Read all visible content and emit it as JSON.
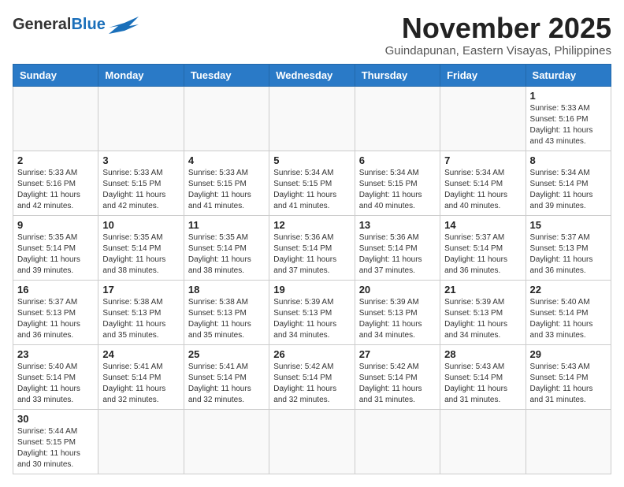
{
  "header": {
    "logo_text_general": "General",
    "logo_text_blue": "Blue",
    "month_title": "November 2025",
    "location": "Guindapunan, Eastern Visayas, Philippines"
  },
  "days_of_week": [
    "Sunday",
    "Monday",
    "Tuesday",
    "Wednesday",
    "Thursday",
    "Friday",
    "Saturday"
  ],
  "weeks": [
    {
      "days": [
        {
          "number": "",
          "sunrise": "",
          "sunset": "",
          "daylight": ""
        },
        {
          "number": "",
          "sunrise": "",
          "sunset": "",
          "daylight": ""
        },
        {
          "number": "",
          "sunrise": "",
          "sunset": "",
          "daylight": ""
        },
        {
          "number": "",
          "sunrise": "",
          "sunset": "",
          "daylight": ""
        },
        {
          "number": "",
          "sunrise": "",
          "sunset": "",
          "daylight": ""
        },
        {
          "number": "",
          "sunrise": "",
          "sunset": "",
          "daylight": ""
        },
        {
          "number": "1",
          "sunrise": "Sunrise: 5:33 AM",
          "sunset": "Sunset: 5:16 PM",
          "daylight": "Daylight: 11 hours and 43 minutes."
        }
      ]
    },
    {
      "days": [
        {
          "number": "2",
          "sunrise": "Sunrise: 5:33 AM",
          "sunset": "Sunset: 5:16 PM",
          "daylight": "Daylight: 11 hours and 42 minutes."
        },
        {
          "number": "3",
          "sunrise": "Sunrise: 5:33 AM",
          "sunset": "Sunset: 5:15 PM",
          "daylight": "Daylight: 11 hours and 42 minutes."
        },
        {
          "number": "4",
          "sunrise": "Sunrise: 5:33 AM",
          "sunset": "Sunset: 5:15 PM",
          "daylight": "Daylight: 11 hours and 41 minutes."
        },
        {
          "number": "5",
          "sunrise": "Sunrise: 5:34 AM",
          "sunset": "Sunset: 5:15 PM",
          "daylight": "Daylight: 11 hours and 41 minutes."
        },
        {
          "number": "6",
          "sunrise": "Sunrise: 5:34 AM",
          "sunset": "Sunset: 5:15 PM",
          "daylight": "Daylight: 11 hours and 40 minutes."
        },
        {
          "number": "7",
          "sunrise": "Sunrise: 5:34 AM",
          "sunset": "Sunset: 5:14 PM",
          "daylight": "Daylight: 11 hours and 40 minutes."
        },
        {
          "number": "8",
          "sunrise": "Sunrise: 5:34 AM",
          "sunset": "Sunset: 5:14 PM",
          "daylight": "Daylight: 11 hours and 39 minutes."
        }
      ]
    },
    {
      "days": [
        {
          "number": "9",
          "sunrise": "Sunrise: 5:35 AM",
          "sunset": "Sunset: 5:14 PM",
          "daylight": "Daylight: 11 hours and 39 minutes."
        },
        {
          "number": "10",
          "sunrise": "Sunrise: 5:35 AM",
          "sunset": "Sunset: 5:14 PM",
          "daylight": "Daylight: 11 hours and 38 minutes."
        },
        {
          "number": "11",
          "sunrise": "Sunrise: 5:35 AM",
          "sunset": "Sunset: 5:14 PM",
          "daylight": "Daylight: 11 hours and 38 minutes."
        },
        {
          "number": "12",
          "sunrise": "Sunrise: 5:36 AM",
          "sunset": "Sunset: 5:14 PM",
          "daylight": "Daylight: 11 hours and 37 minutes."
        },
        {
          "number": "13",
          "sunrise": "Sunrise: 5:36 AM",
          "sunset": "Sunset: 5:14 PM",
          "daylight": "Daylight: 11 hours and 37 minutes."
        },
        {
          "number": "14",
          "sunrise": "Sunrise: 5:37 AM",
          "sunset": "Sunset: 5:14 PM",
          "daylight": "Daylight: 11 hours and 36 minutes."
        },
        {
          "number": "15",
          "sunrise": "Sunrise: 5:37 AM",
          "sunset": "Sunset: 5:13 PM",
          "daylight": "Daylight: 11 hours and 36 minutes."
        }
      ]
    },
    {
      "days": [
        {
          "number": "16",
          "sunrise": "Sunrise: 5:37 AM",
          "sunset": "Sunset: 5:13 PM",
          "daylight": "Daylight: 11 hours and 36 minutes."
        },
        {
          "number": "17",
          "sunrise": "Sunrise: 5:38 AM",
          "sunset": "Sunset: 5:13 PM",
          "daylight": "Daylight: 11 hours and 35 minutes."
        },
        {
          "number": "18",
          "sunrise": "Sunrise: 5:38 AM",
          "sunset": "Sunset: 5:13 PM",
          "daylight": "Daylight: 11 hours and 35 minutes."
        },
        {
          "number": "19",
          "sunrise": "Sunrise: 5:39 AM",
          "sunset": "Sunset: 5:13 PM",
          "daylight": "Daylight: 11 hours and 34 minutes."
        },
        {
          "number": "20",
          "sunrise": "Sunrise: 5:39 AM",
          "sunset": "Sunset: 5:13 PM",
          "daylight": "Daylight: 11 hours and 34 minutes."
        },
        {
          "number": "21",
          "sunrise": "Sunrise: 5:39 AM",
          "sunset": "Sunset: 5:13 PM",
          "daylight": "Daylight: 11 hours and 34 minutes."
        },
        {
          "number": "22",
          "sunrise": "Sunrise: 5:40 AM",
          "sunset": "Sunset: 5:14 PM",
          "daylight": "Daylight: 11 hours and 33 minutes."
        }
      ]
    },
    {
      "days": [
        {
          "number": "23",
          "sunrise": "Sunrise: 5:40 AM",
          "sunset": "Sunset: 5:14 PM",
          "daylight": "Daylight: 11 hours and 33 minutes."
        },
        {
          "number": "24",
          "sunrise": "Sunrise: 5:41 AM",
          "sunset": "Sunset: 5:14 PM",
          "daylight": "Daylight: 11 hours and 32 minutes."
        },
        {
          "number": "25",
          "sunrise": "Sunrise: 5:41 AM",
          "sunset": "Sunset: 5:14 PM",
          "daylight": "Daylight: 11 hours and 32 minutes."
        },
        {
          "number": "26",
          "sunrise": "Sunrise: 5:42 AM",
          "sunset": "Sunset: 5:14 PM",
          "daylight": "Daylight: 11 hours and 32 minutes."
        },
        {
          "number": "27",
          "sunrise": "Sunrise: 5:42 AM",
          "sunset": "Sunset: 5:14 PM",
          "daylight": "Daylight: 11 hours and 31 minutes."
        },
        {
          "number": "28",
          "sunrise": "Sunrise: 5:43 AM",
          "sunset": "Sunset: 5:14 PM",
          "daylight": "Daylight: 11 hours and 31 minutes."
        },
        {
          "number": "29",
          "sunrise": "Sunrise: 5:43 AM",
          "sunset": "Sunset: 5:14 PM",
          "daylight": "Daylight: 11 hours and 31 minutes."
        }
      ]
    },
    {
      "days": [
        {
          "number": "30",
          "sunrise": "Sunrise: 5:44 AM",
          "sunset": "Sunset: 5:15 PM",
          "daylight": "Daylight: 11 hours and 30 minutes."
        },
        {
          "number": "",
          "sunrise": "",
          "sunset": "",
          "daylight": ""
        },
        {
          "number": "",
          "sunrise": "",
          "sunset": "",
          "daylight": ""
        },
        {
          "number": "",
          "sunrise": "",
          "sunset": "",
          "daylight": ""
        },
        {
          "number": "",
          "sunrise": "",
          "sunset": "",
          "daylight": ""
        },
        {
          "number": "",
          "sunrise": "",
          "sunset": "",
          "daylight": ""
        },
        {
          "number": "",
          "sunrise": "",
          "sunset": "",
          "daylight": ""
        }
      ]
    }
  ]
}
